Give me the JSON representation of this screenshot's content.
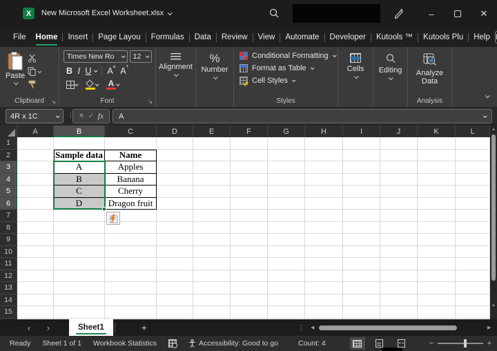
{
  "titlebar": {
    "title": "New Microsoft Excel Worksheet.xlsx"
  },
  "menubar": {
    "items": [
      "File",
      "Home",
      "Insert",
      "Page Layou",
      "Formulas",
      "Data",
      "Review",
      "View",
      "Automate",
      "Developer",
      "Kutools ™",
      "Kutools Plu",
      "Help"
    ],
    "active_item": "Home"
  },
  "ribbon": {
    "clipboard": {
      "label": "Clipboard",
      "paste": "Paste"
    },
    "font": {
      "label": "Font",
      "font_name": "Times New Ro",
      "font_size": "12",
      "bold": "B",
      "italic": "I",
      "underline": "U",
      "grow": "A",
      "shrink": "A",
      "font_color_letter": "A"
    },
    "alignment": {
      "label": "Alignment"
    },
    "number": {
      "label": "Number",
      "symbol": "%"
    },
    "styles": {
      "label": "Styles",
      "items": [
        "Conditional Formatting",
        "Format as Table",
        "Cell Styles"
      ]
    },
    "cells": {
      "label": "Cells"
    },
    "editing": {
      "label": "Editing"
    },
    "analysis": {
      "label": "Analysis",
      "button": "Analyze Data"
    }
  },
  "formula_bar": {
    "name_box": "4R x 1C",
    "cancel": "✕",
    "enter": "✓",
    "fx": "fx",
    "content": "A"
  },
  "grid": {
    "columns": [
      "A",
      "B",
      "C",
      "D",
      "E",
      "F",
      "G",
      "H",
      "I",
      "J",
      "K",
      "L"
    ],
    "visible_rows": 16,
    "selected_column": "B",
    "selected_rows": [
      3,
      4,
      5,
      6
    ],
    "table": {
      "origin": "B2",
      "headers": [
        "Sample data",
        "Name"
      ],
      "rows": [
        [
          "A",
          "Apples"
        ],
        [
          "B",
          "Banana"
        ],
        [
          "C",
          "Cherry"
        ],
        [
          "D",
          "Dragon fruit"
        ]
      ]
    }
  },
  "sheet_tabs": {
    "tabs": [
      "Sheet1"
    ],
    "active_tab": "Sheet1",
    "add_label": "+"
  },
  "status_bar": {
    "mode": "Ready",
    "sheet_info": "Sheet 1 of 1",
    "workbook_statistics": "Workbook Statistics",
    "accessibility": "Accessibility: Good to go",
    "count": "Count: 4",
    "zoom_out": "−",
    "zoom_in": "+"
  },
  "colors": {
    "accent_green": "#21a366",
    "selection_border": "#107c41",
    "selection_fill": "#c9c9c9",
    "fill_color_swatch": "#ffd400",
    "font_color_swatch": "#e03c31"
  }
}
